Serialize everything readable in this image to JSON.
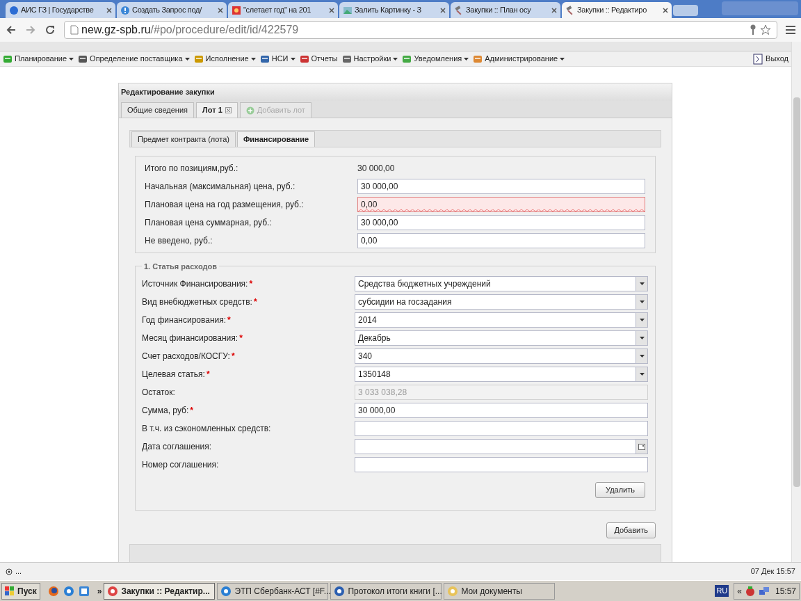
{
  "browser_tabs": [
    {
      "title": "АИС ГЗ | Государстве",
      "selected": false,
      "kind": "globe"
    },
    {
      "title": "Создать Запрос под/",
      "selected": false,
      "kind": "help"
    },
    {
      "title": "\"слетает год\" на 201",
      "selected": false,
      "kind": "flag"
    },
    {
      "title": "Залить Картинку - З",
      "selected": false,
      "kind": "image"
    },
    {
      "title": "Закупки :: План осу",
      "selected": false,
      "kind": "gavel"
    },
    {
      "title": "Закупки :: Редактиро",
      "selected": true,
      "kind": "gavel"
    }
  ],
  "address": {
    "host": "new.gz-spb.ru",
    "path": "/#po/procedure/edit/id/422579"
  },
  "menu": [
    {
      "label": "Планирование",
      "dropdown": true
    },
    {
      "label": "Определение поставщика",
      "dropdown": true
    },
    {
      "label": "Исполнение",
      "dropdown": true
    },
    {
      "label": "НСИ",
      "dropdown": true
    },
    {
      "label": "Отчеты",
      "dropdown": false
    },
    {
      "label": "Настройки",
      "dropdown": true
    },
    {
      "label": "Уведомления",
      "dropdown": true
    },
    {
      "label": "Администрирование",
      "dropdown": true
    }
  ],
  "logout": "Выход",
  "panel": {
    "title": "Редактирование закупки",
    "tabs": [
      {
        "label": "Общие сведения",
        "selected": false,
        "kind": "tab",
        "closable": false
      },
      {
        "label": "Лот 1",
        "selected": true,
        "kind": "tab",
        "closable": true
      },
      {
        "label": "Добавить лот",
        "selected": false,
        "kind": "add",
        "closable": false
      }
    ],
    "subtabs": [
      {
        "label": "Предмет контракта (лота)",
        "selected": false
      },
      {
        "label": "Финансирование",
        "selected": true
      }
    ],
    "totals": [
      {
        "label": "Итого по позициям,руб.:",
        "value": "30 000,00",
        "kind": "display"
      },
      {
        "label": "Начальная (максимальная) цена, руб.:",
        "value": "30 000,00",
        "kind": "input",
        "invalid": false
      },
      {
        "label": "Плановая цена на год размещения, руб.:",
        "value": "0,00",
        "kind": "input",
        "invalid": true
      },
      {
        "label": "Плановая цена суммарная, руб.:",
        "value": "30 000,00",
        "kind": "input",
        "invalid": false
      },
      {
        "label": "Не введено, руб.:",
        "value": "0,00",
        "kind": "input",
        "invalid": false
      }
    ],
    "section": {
      "legend": "1. Статья расходов",
      "required_mark": "*",
      "fields": [
        {
          "label": "Источник Финансирования:",
          "required": true,
          "kind": "select",
          "value": "Средства бюджетных учреждений"
        },
        {
          "label": "Вид внебюджетных средств:",
          "required": true,
          "kind": "select",
          "value": "субсидии на госзадания"
        },
        {
          "label": "Год финансирования:",
          "required": true,
          "kind": "select",
          "value": "2014"
        },
        {
          "label": "Месяц финансирования:",
          "required": true,
          "kind": "select",
          "value": "Декабрь"
        },
        {
          "label": "Счет расходов/КОСГУ:",
          "required": true,
          "kind": "select",
          "value": "340"
        },
        {
          "label": "Целевая статья:",
          "required": true,
          "kind": "select",
          "value": "1350148"
        },
        {
          "label": "Остаток:",
          "required": false,
          "kind": "disabled",
          "value": "3 033 038,28"
        },
        {
          "label": "Сумма, руб:",
          "required": true,
          "kind": "input",
          "value": "30 000,00"
        },
        {
          "label": "В т.ч. из сэкономленных средств:",
          "required": false,
          "kind": "input"
        },
        {
          "label": "Дата соглашения:",
          "required": false,
          "kind": "date"
        },
        {
          "label": "Номер соглашения:",
          "required": false,
          "kind": "input"
        }
      ],
      "delete_button": "Удалить"
    },
    "add_button": "Добавить"
  },
  "status": {
    "text": "...",
    "time": "07 Дек 15:57"
  },
  "taskbar": {
    "start": "Пуск",
    "more": "»",
    "tasks": [
      {
        "title": "Закупки :: Редактир...",
        "selected": true,
        "kind": "chrome"
      },
      {
        "title": "ЭТП Сбербанк-АСТ [#F...",
        "selected": false,
        "kind": "ie"
      },
      {
        "title": "Протокол итоги книги [...",
        "selected": false,
        "kind": "word"
      },
      {
        "title": "Мои документы",
        "selected": false,
        "kind": "folder"
      }
    ],
    "lang": "RU",
    "tray_toggle": "«",
    "clock": "15:57"
  }
}
